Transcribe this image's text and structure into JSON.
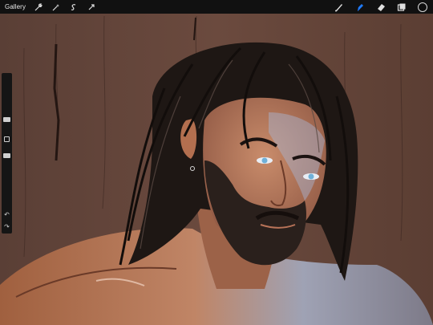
{
  "app": {
    "gallery_label": "Gallery"
  },
  "toolbar": {
    "left_tools": [
      "wrench-icon",
      "magic-wand-icon",
      "selection-icon",
      "transform-arrow-icon"
    ],
    "right_tools": [
      "brush-icon",
      "smudge-icon",
      "eraser-icon",
      "layers-icon",
      "color-swatch"
    ],
    "active_tool": "smudge-icon",
    "accent": "#1f7bff",
    "current_color": "#0e0e0e"
  },
  "sidebar": {
    "controls": [
      "brush-size-slider",
      "modify-button",
      "opacity-slider",
      "undo-icon",
      "redo-icon"
    ]
  }
}
